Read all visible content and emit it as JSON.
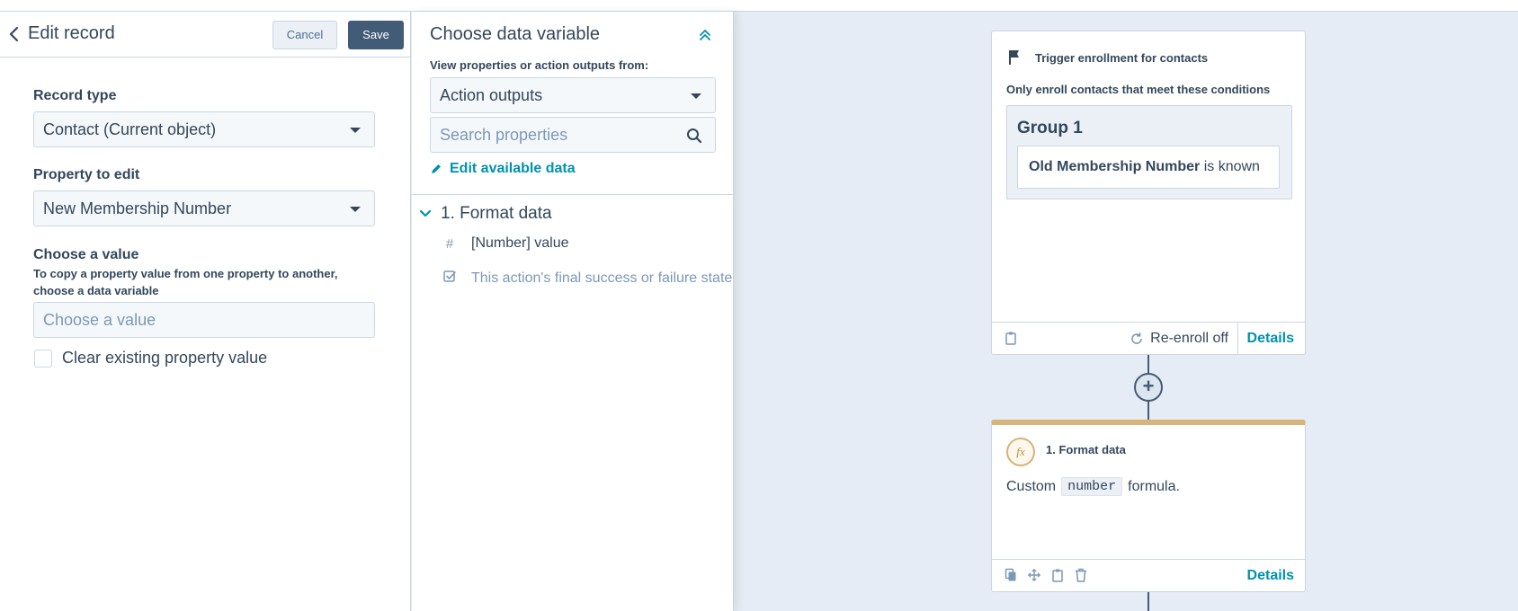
{
  "record_panel": {
    "title": "Edit record",
    "cancel_label": "Cancel",
    "save_label": "Save",
    "record_type": {
      "label": "Record type",
      "value": "Contact (Current object)"
    },
    "property_to_edit": {
      "label": "Property to edit",
      "value": "New Membership Number"
    },
    "choose_value": {
      "label": "Choose a value",
      "help": "To copy a property value from one property to another, choose a data variable",
      "placeholder": "Choose a value"
    },
    "clear_checkbox": {
      "label": "Clear existing property value",
      "checked": false
    }
  },
  "variable_panel": {
    "title": "Choose data variable",
    "view_label": "View properties or action outputs from:",
    "source_value": "Action outputs",
    "search_placeholder": "Search properties",
    "edit_link": "Edit available data",
    "group": {
      "label": "1. Format data",
      "options": [
        {
          "icon": "hash-icon",
          "label": "[Number] value",
          "enabled": true
        },
        {
          "icon": "check-shield-icon",
          "label": "This action's final success or failure state",
          "enabled": false
        }
      ]
    }
  },
  "workflow": {
    "trigger_card": {
      "title": "Trigger enrollment for contacts",
      "subtitle": "Only enroll contacts that meet these conditions",
      "group_title": "Group 1",
      "condition_property": "Old Membership Number",
      "condition_operator": "is known",
      "reenroll_label": "Re-enroll off",
      "details_label": "Details"
    },
    "add_node_symbol": "+",
    "action_card": {
      "badge": "fx",
      "title": "1. Format data",
      "desc_prefix": "Custom",
      "desc_code": "number",
      "desc_suffix": "formula.",
      "details_label": "Details"
    }
  },
  "colors": {
    "link": "#0091ae",
    "text": "#33475b",
    "canvas": "#e6ecf5",
    "action_accent": "#d8b47a",
    "save_button": "#425b76"
  }
}
